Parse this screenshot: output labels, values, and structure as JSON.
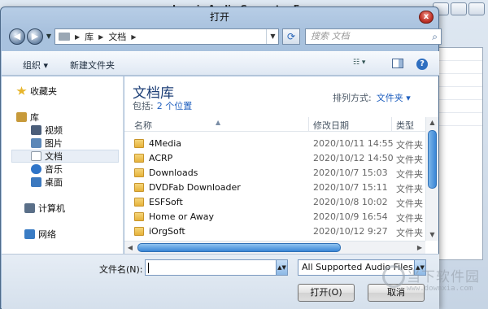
{
  "background_app": {
    "title": "Leapic Audio Converter Free"
  },
  "dialog": {
    "title": "打开",
    "close_glyph": "x"
  },
  "nav": {
    "back_glyph": "◀",
    "forward_glyph": "▶",
    "breadcrumb": [
      "库",
      "文档"
    ],
    "search_placeholder": "搜索 文档"
  },
  "toolbar": {
    "organize_label": "组织 ▾",
    "new_folder_label": "新建文件夹"
  },
  "sidebar": {
    "items": [
      {
        "label": "收藏夹",
        "icon": "star-icon",
        "color": "#e7b52c"
      },
      {
        "label": "库",
        "icon": "library-icon",
        "color": "#c79a3a"
      },
      {
        "label": "视频",
        "icon": "video-icon",
        "color": "#4b5e7a"
      },
      {
        "label": "图片",
        "icon": "pictures-icon",
        "color": "#5b87b8"
      },
      {
        "label": "文档",
        "icon": "documents-icon",
        "color": "#cfd6de"
      },
      {
        "label": "音乐",
        "icon": "music-icon",
        "color": "#2e74c8"
      },
      {
        "label": "桌面",
        "icon": "desktop-icon",
        "color": "#3c79bf"
      },
      {
        "label": "计算机",
        "icon": "computer-icon",
        "color": "#5a6f88"
      },
      {
        "label": "网络",
        "icon": "network-icon",
        "color": "#3a7cc4"
      }
    ]
  },
  "main": {
    "library_title": "文档库",
    "includes_label": "包括:",
    "includes_link": "2 个位置",
    "arrange_label": "排列方式:",
    "arrange_value": "文件夹 ▾",
    "columns": {
      "name": "名称",
      "date": "修改日期",
      "type": "类型"
    },
    "rows": [
      {
        "name": "4Media",
        "date": "2020/10/11 14:55",
        "type": "文件夹"
      },
      {
        "name": "ACRP",
        "date": "2020/10/12 14:50",
        "type": "文件夹"
      },
      {
        "name": "Downloads",
        "date": "2020/10/7 15:03",
        "type": "文件夹"
      },
      {
        "name": "DVDFab Downloader",
        "date": "2020/10/7 15:11",
        "type": "文件夹"
      },
      {
        "name": "ESFSoft",
        "date": "2020/10/8 10:02",
        "type": "文件夹"
      },
      {
        "name": "Home or Away",
        "date": "2020/10/9 16:54",
        "type": "文件夹"
      },
      {
        "name": "iOrgSoft",
        "date": "2020/10/12 9:27",
        "type": "文件夹"
      }
    ]
  },
  "bottom": {
    "filename_label": "文件名(N):",
    "filename_value": "",
    "filetype_value": "All Supported Audio Files",
    "open_label": "打开(O)",
    "cancel_label": "取消"
  },
  "watermark": {
    "text": "当下软件园",
    "sub": "www.downxia.com"
  },
  "colors": {
    "accent": "#1f5fbf",
    "title_blue": "#1c3e76",
    "folder_yellow": "#e6b23a"
  }
}
